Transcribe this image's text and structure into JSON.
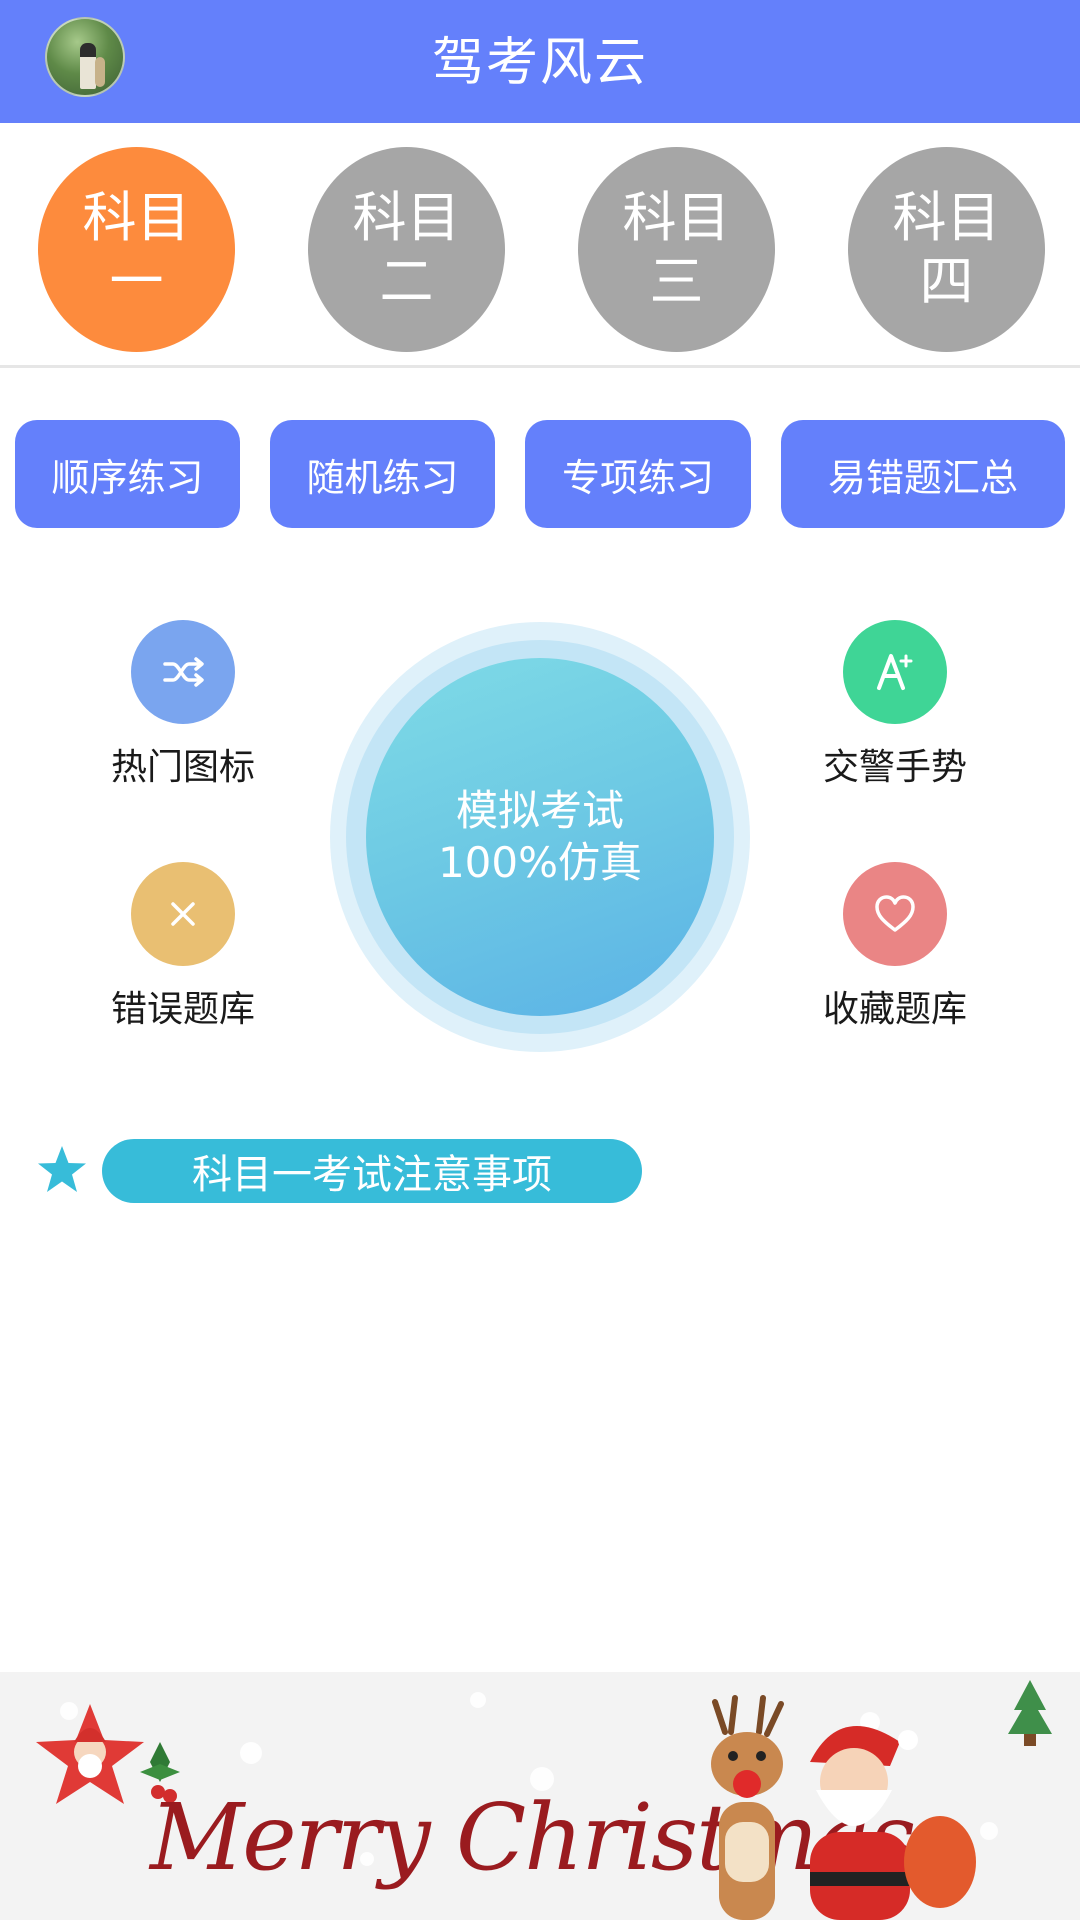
{
  "header": {
    "title": "驾考风云",
    "avatar": "avatar"
  },
  "subjects": [
    {
      "line1": "科目",
      "line2": "一",
      "active": true
    },
    {
      "line1": "科目",
      "line2": "二",
      "active": false
    },
    {
      "line1": "科目",
      "line2": "三",
      "active": false
    },
    {
      "line1": "科目",
      "line2": "四",
      "active": false
    }
  ],
  "practice": [
    {
      "label": "顺序练习"
    },
    {
      "label": "随机练习"
    },
    {
      "label": "专项练习"
    },
    {
      "label": "易错题汇总"
    }
  ],
  "features": {
    "hot_signs": {
      "label": "热门图标",
      "icon": "shuffle-icon",
      "color": "#7aa5ef"
    },
    "traffic_gestures": {
      "label": "交警手势",
      "icon": "a-plus-icon",
      "color": "#3fd596"
    },
    "wrong_bank": {
      "label": "错误题库",
      "icon": "close-icon",
      "color": "#e9bf72"
    },
    "favorites": {
      "label": "收藏题库",
      "icon": "heart-icon",
      "color": "#ea8585"
    }
  },
  "exam": {
    "line1": "模拟考试",
    "line2": "100%仿真"
  },
  "notice": {
    "label": "科目一考试注意事项",
    "icon": "star-icon",
    "color": "#37bcd9"
  },
  "banner": {
    "text": "Merry Christmas"
  },
  "colors": {
    "header": "#6480fb",
    "active_subject": "#fd8b3d",
    "inactive_subject": "#a6a6a6"
  }
}
